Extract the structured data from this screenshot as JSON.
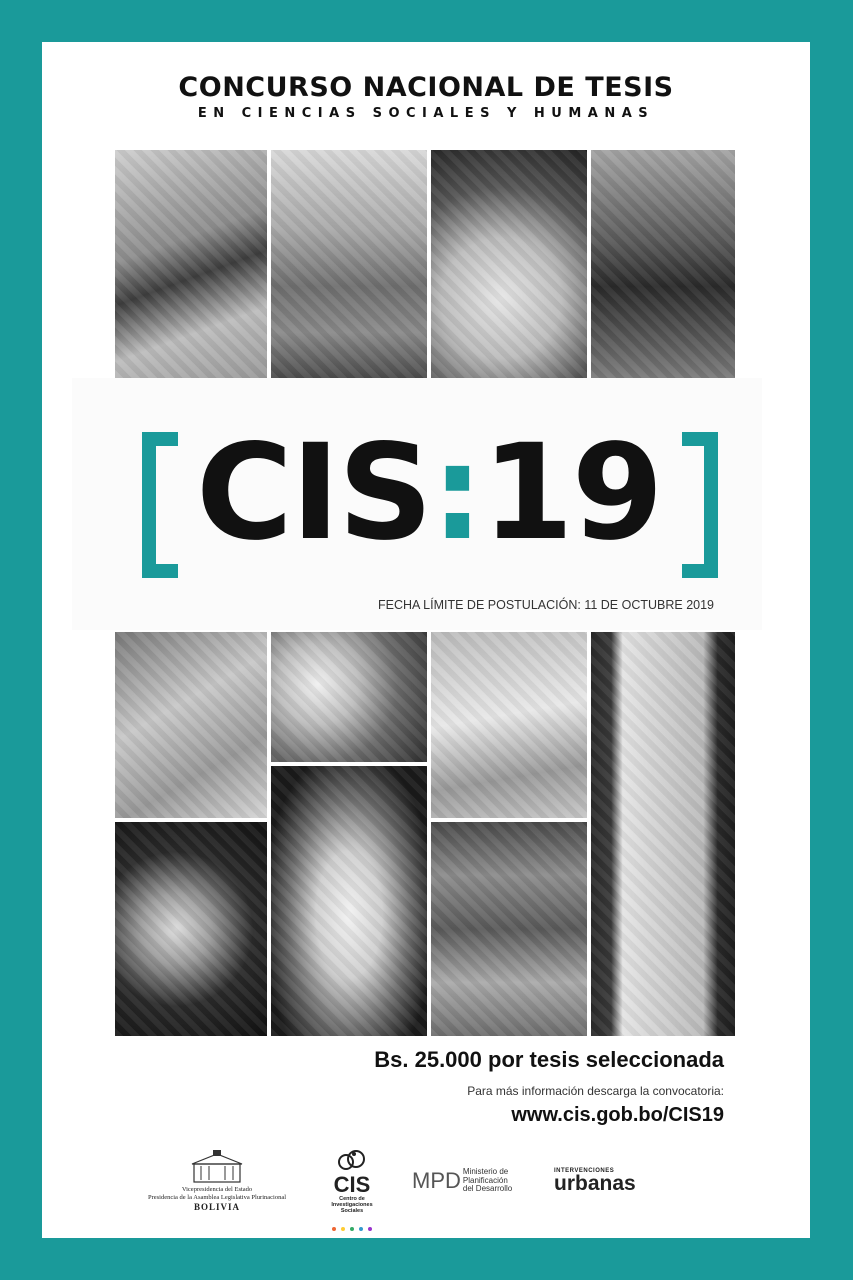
{
  "title": {
    "main": "CONCURSO NACIONAL DE TESIS",
    "sub": "EN CIENCIAS SOCIALES Y HUMANAS"
  },
  "logo": {
    "left": "CIS",
    "colon": ":",
    "right": "19"
  },
  "deadline": "FECHA LÍMITE DE POSTULACIÓN:  11 DE OCTUBRE 2019",
  "prize": "Bs.  25.000 por tesis seleccionada",
  "info": "Para más información descarga la convocatoria:",
  "url": "www.cis.gob.bo/CIS19",
  "sponsors": {
    "vp_line1": "Vicepresidencia del Estado",
    "vp_line2": "Presidencia de la Asamblea Legislativa Plurinacional",
    "vp_line3": "BOLIVIA",
    "cis_word": "CIS",
    "cis_sub": "Centro de Investigaciones Sociales",
    "mpd_abbr": "MPD",
    "mpd_name": "Ministerio de Planificación del Desarrollo",
    "urb_small": "INTERVENCIONES",
    "urb_big": "urbanas"
  },
  "colors": {
    "frame": "#1a9a9a",
    "accent": "#1a9a9a"
  }
}
